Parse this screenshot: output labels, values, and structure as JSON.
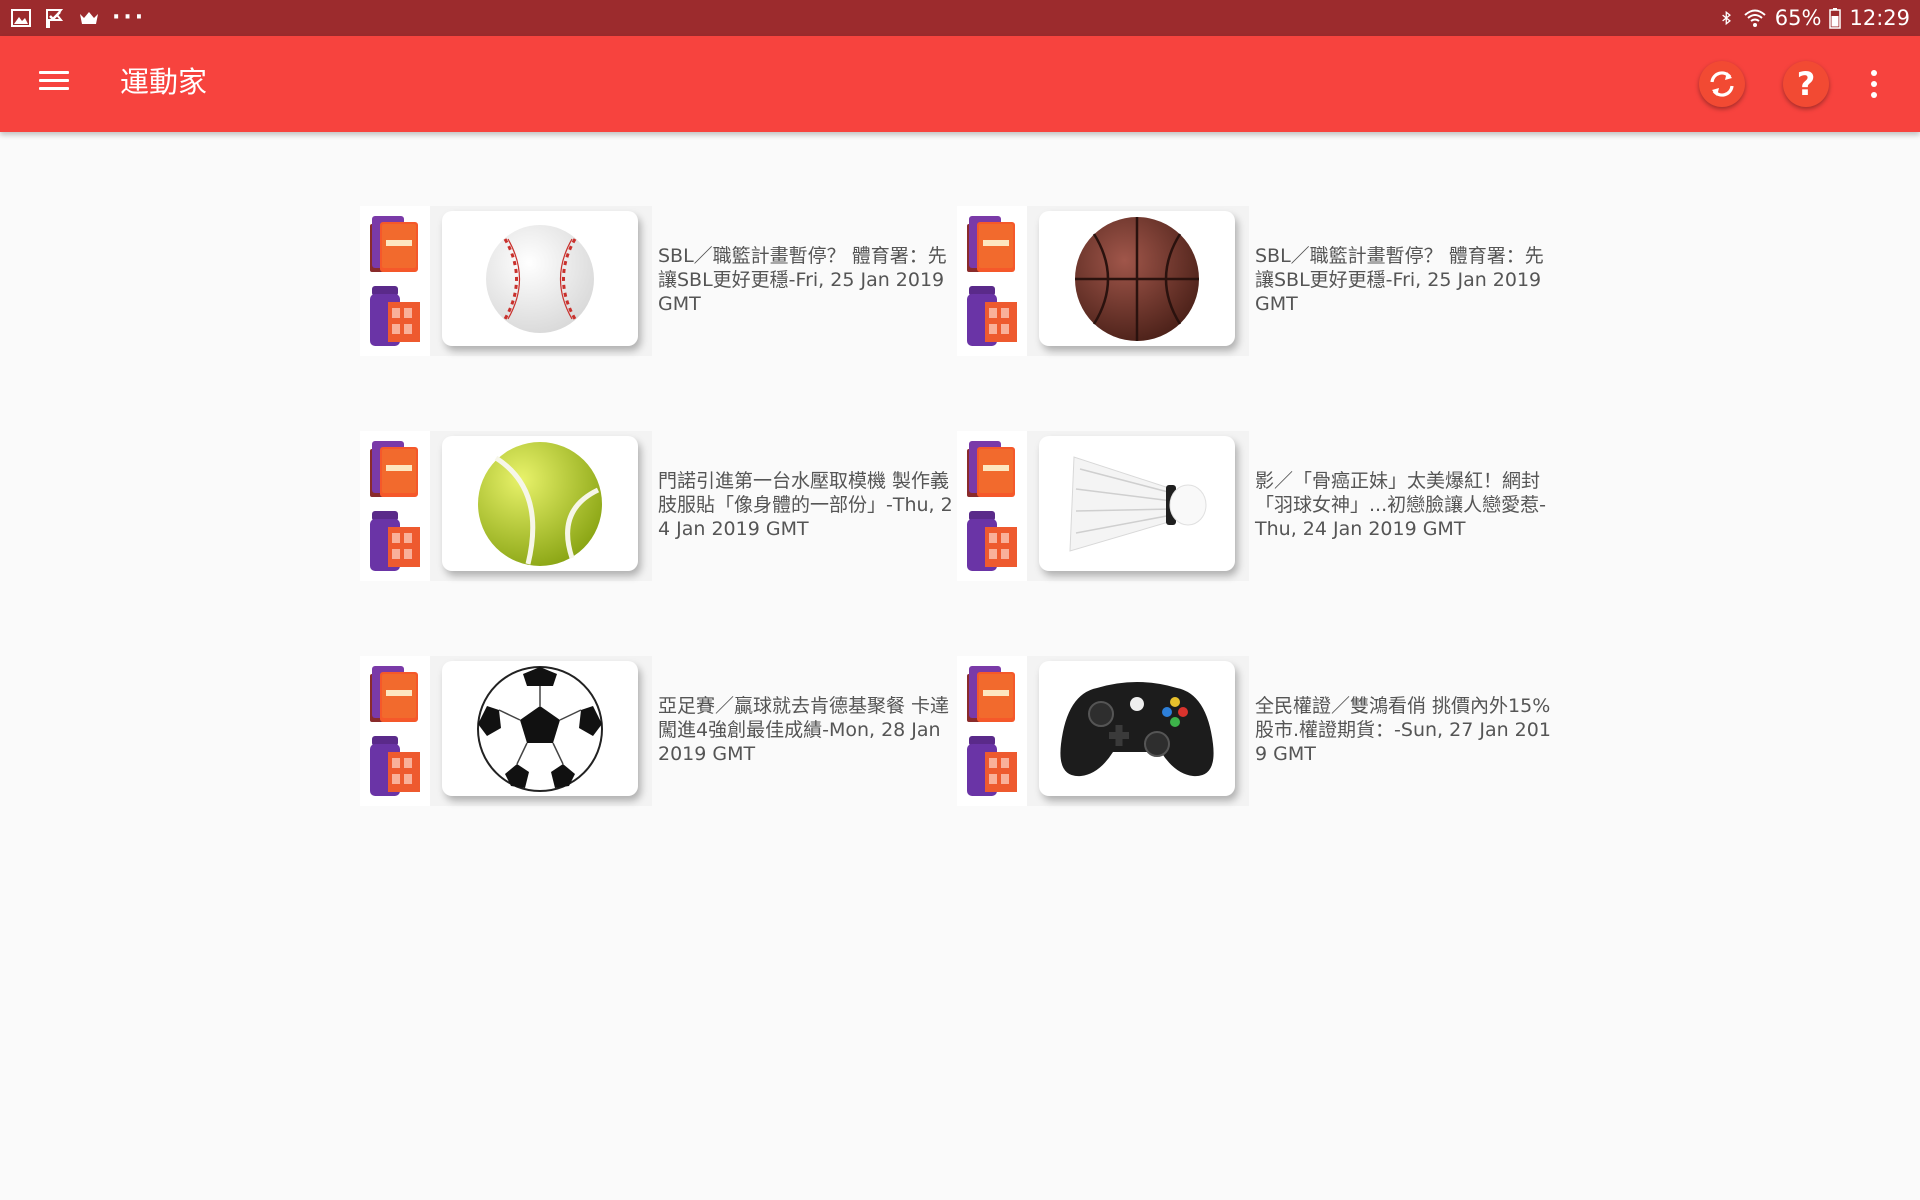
{
  "status_bar": {
    "time": "12:29",
    "battery": "65%",
    "left_icons": [
      "image-icon",
      "check-flag-icon",
      "crown-icon"
    ],
    "more": "···"
  },
  "app_bar": {
    "title": "運動家",
    "help_label": "?",
    "accent_color": "#f7433e",
    "status_color": "#9c2b2d"
  },
  "cards": [
    {
      "thumb_icon": "baseball-icon",
      "text": "SBL／職籃計畫暫停？ 體育署：先讓SBL更好更穩-Fri, 25 Jan 2019 GMT"
    },
    {
      "thumb_icon": "basketball-icon",
      "text": "SBL／職籃計畫暫停？ 體育署：先讓SBL更好更穩-Fri, 25 Jan 2019 GMT"
    },
    {
      "thumb_icon": "tennis-ball-icon",
      "text": "門諾引進第一台水壓取模機 製作義肢服貼「像身體的一部份」-Thu, 24 Jan 2019 GMT"
    },
    {
      "thumb_icon": "shuttlecock-icon",
      "text": "影／「骨癌正妹」太美爆紅！網封「羽球女神」...初戀臉讓人戀愛惹-Thu, 24 Jan 2019 GMT"
    },
    {
      "thumb_icon": "soccer-ball-icon",
      "text": "亞足賽／贏球就去肯德基聚餐 卡達闖進4強創最佳成績-Mon, 28 Jan 2019 GMT"
    },
    {
      "thumb_icon": "game-controller-icon",
      "text": "全民權證／雙鴻看俏 挑價內外15% 股市.權證期貨：-Sun, 27 Jan 2019 GMT"
    }
  ]
}
